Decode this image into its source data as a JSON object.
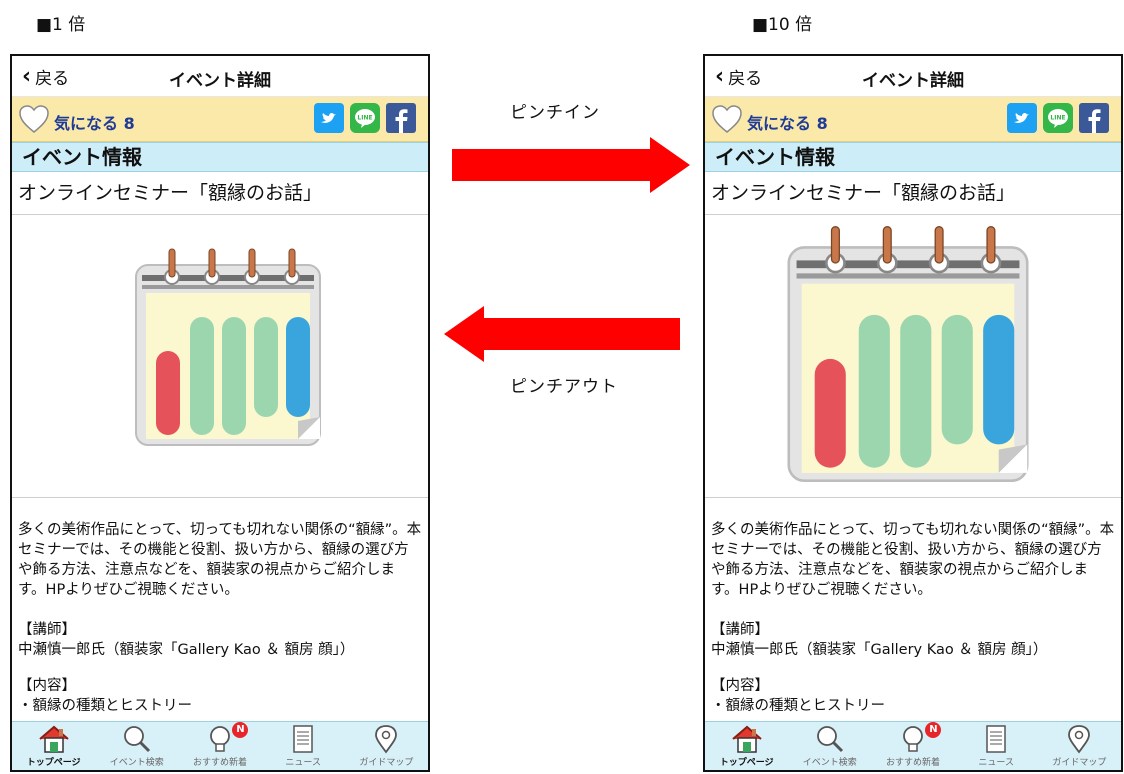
{
  "captions": {
    "left": "■1 倍",
    "right": "■10 倍"
  },
  "gestures": {
    "pinch_in": "ピンチイン",
    "pinch_out": "ピンチアウト"
  },
  "screen": {
    "nav": {
      "back_label": "戻る",
      "title": "イベント詳細"
    },
    "favorite": {
      "label": "気になる 8"
    },
    "section_title": "イベント情報",
    "event_title": "オンラインセミナー「額縁のお話」",
    "description": "多くの美術作品にとって、切っても切れない関係の“額縁”。本セミナーでは、その機能と役割、扱い方から、額縁の選び方や飾る方法、注意点などを、額装家の視点からご紹介します。HPよりぜひご視聴ください。",
    "lecturer_heading": "【講師】",
    "lecturer": "中瀬慎一郎氏（額装家「Gallery Kao ＆ 額房 顔」）",
    "content_heading": "【内容】",
    "content_item": "・額縁の種類とヒストリー",
    "tabs": [
      {
        "label": "トップページ",
        "icon": "home-icon"
      },
      {
        "label": "イベント検索",
        "icon": "magnifier-icon"
      },
      {
        "label": "おすすめ新着",
        "icon": "lightbulb-icon",
        "badge": "N"
      },
      {
        "label": "ニュース",
        "icon": "news-icon"
      },
      {
        "label": "ガイドマップ",
        "icon": "map-pin-icon"
      }
    ],
    "colors": {
      "favorite_bar": "#fbe9a9",
      "section_bar": "#cdeef8",
      "tab_bar": "#d8f1f8",
      "arrow": "#ff0000"
    }
  }
}
